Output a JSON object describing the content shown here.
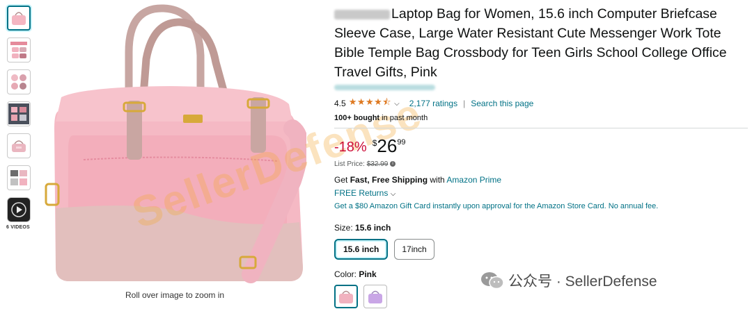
{
  "thumbnails": {
    "items": [
      {
        "name": "thumb-pink-bag-front",
        "color": "#f4b6c2"
      },
      {
        "name": "thumb-bag-features",
        "color": "#d98b9a"
      },
      {
        "name": "thumb-bag-details",
        "color": "#e6a9b4"
      },
      {
        "name": "thumb-bag-dimensions",
        "color": "#555a66"
      },
      {
        "name": "thumb-bag-lifestyle",
        "color": "#eab6c0"
      },
      {
        "name": "thumb-bag-compartments",
        "color": "#6c6c6c"
      }
    ],
    "video_label": "6 VIDEOS"
  },
  "main_image": {
    "zoom_hint": "Roll over image to zoom in"
  },
  "product": {
    "title": "Laptop Bag for Women, 15.6 inch Computer Briefcase Sleeve Case, Large Water Resistant Cute Messenger Work Tote Bible Temple Bag Crossbody for Teen Girls School College Office Travel Gifts, Pink",
    "rating_value": "4.5",
    "stars": "★★★★⯪",
    "ratings_count": "2,177 ratings",
    "separator": "|",
    "search_page": "Search this page",
    "bought_bold": "100+ bought",
    "bought_rest": " in past month",
    "discount": "-18%",
    "currency": "$",
    "price_whole": "26",
    "price_fraction": "99",
    "list_price_label": "List Price: ",
    "list_price": "$32.99",
    "shipping_prefix": "Get ",
    "shipping_bold": "Fast, Free Shipping",
    "shipping_with": " with ",
    "shipping_link": "Amazon Prime",
    "free_returns": "FREE Returns",
    "gift_card": "Get a $80 Amazon Gift Card instantly upon approval for the Amazon Store Card. No annual fee.",
    "size_label": "Size: ",
    "size_selected": "15.6 inch",
    "sizes": [
      "15.6 inch",
      "17inch"
    ],
    "color_label": "Color: ",
    "color_selected": "Pink",
    "colors": [
      "#f1b2bf",
      "#c9a6e6"
    ]
  },
  "watermark": {
    "diagonal": "SellerDefense",
    "wechat": "公众号 · SellerDefense"
  },
  "colors": {
    "link": "#007185",
    "discount": "#cc0c39",
    "star": "#de7921",
    "accent_watermark": "#f3aa3c"
  }
}
